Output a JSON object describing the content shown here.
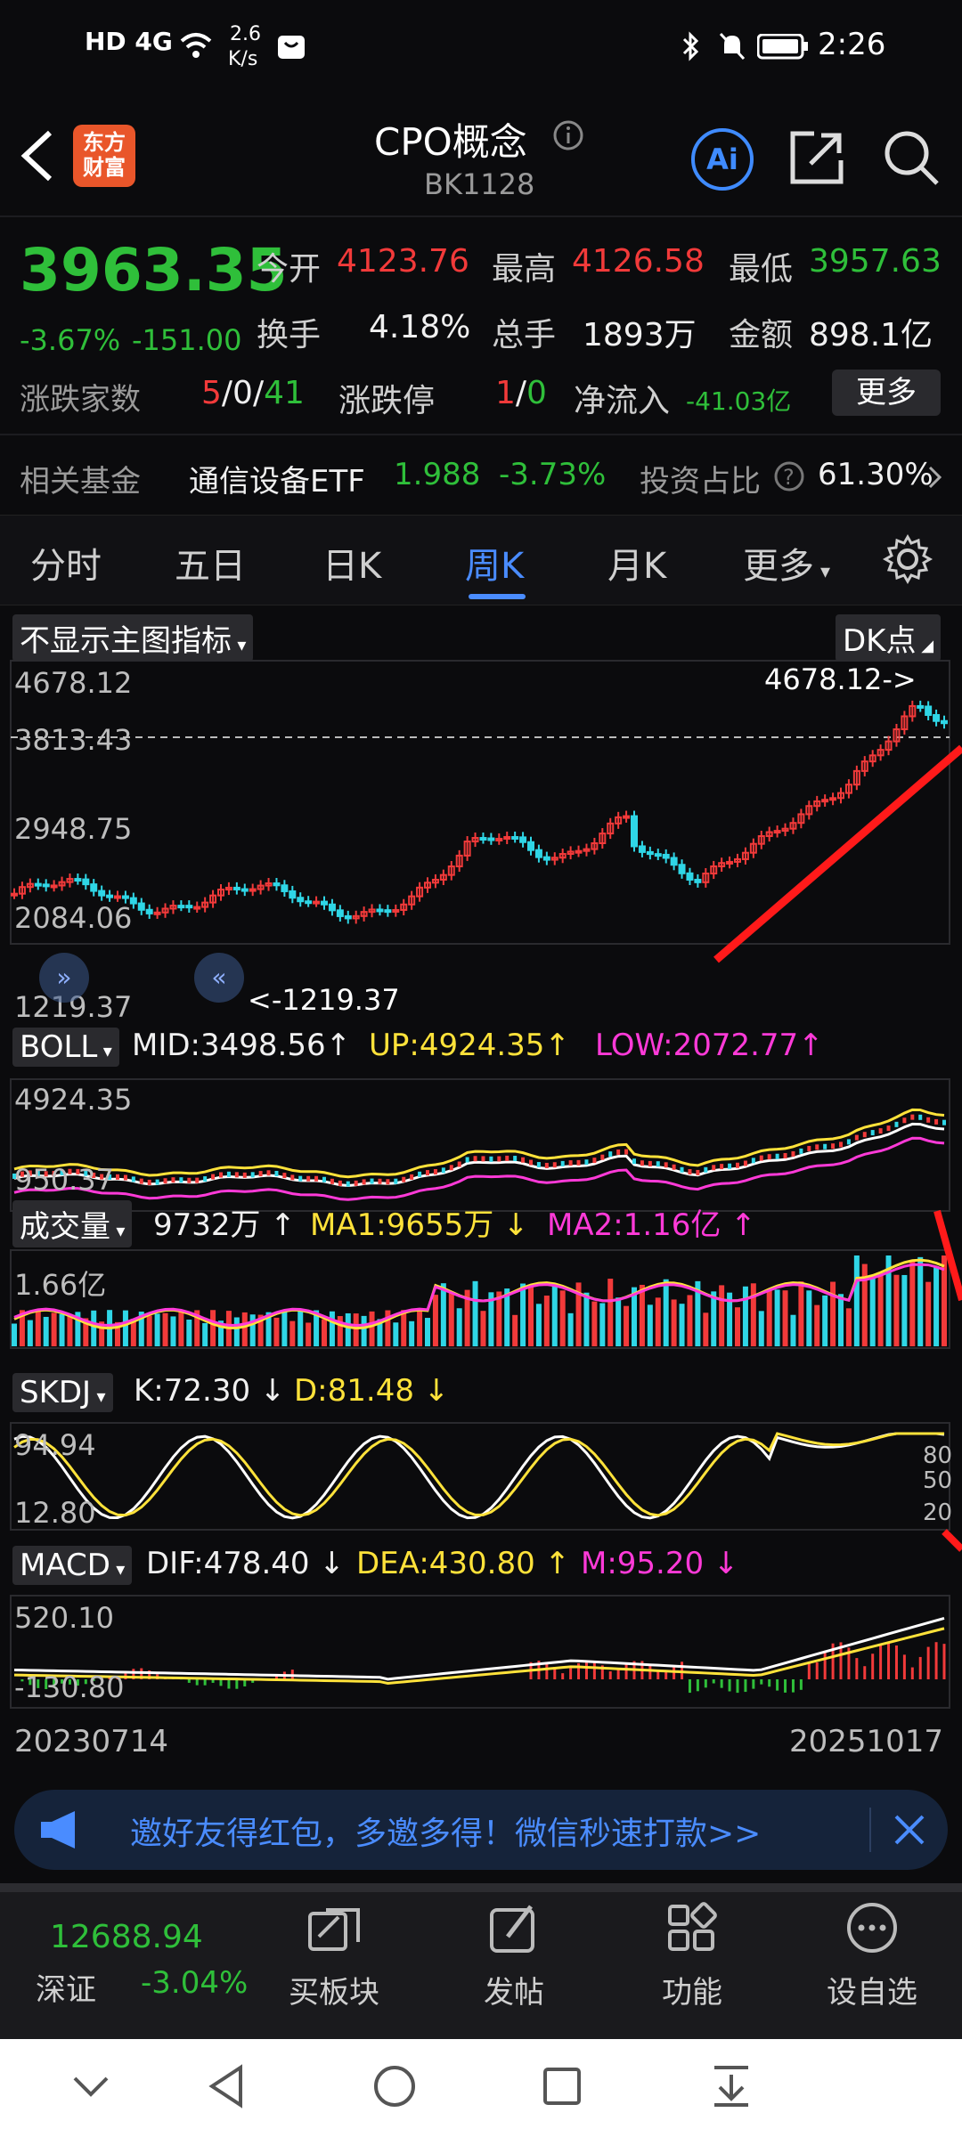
{
  "status_bar": {
    "left_icons": "HD 4G",
    "speed": "2.6",
    "speed_unit": "K/s",
    "time": "2:26"
  },
  "header": {
    "logo_line1": "东方",
    "logo_line2": "财富",
    "title": "CPO概念",
    "code": "BK1128",
    "ai_label": "Ai"
  },
  "quote": {
    "price": "3963.35",
    "change_pct": "-3.67%",
    "change_amt": "-151.00",
    "open_label": "今开",
    "open": "4123.76",
    "high_label": "最高",
    "high": "4126.58",
    "low_label": "最低",
    "low": "3957.63",
    "turnover_label": "换手",
    "turnover": "4.18%",
    "volume_label": "总手",
    "volume": "1893万",
    "amount_label": "金额",
    "amount": "898.1亿",
    "updown_label": "涨跌家数",
    "up": "5",
    "flat": "0",
    "down": "41",
    "limit_label": "涨跌停",
    "limit_up": "1",
    "limit_down": "0",
    "netflow_label": "净流入",
    "netflow": "-41.03亿",
    "more_button": "更多",
    "fund_label": "相关基金",
    "fund_name": "通信设备ETF",
    "fund_price": "1.988",
    "fund_change": "-3.73%",
    "ratio_label": "投资占比",
    "ratio": "61.30%"
  },
  "tabs": [
    "分时",
    "五日",
    "日K",
    "周K",
    "月K",
    "更多"
  ],
  "active_tab": "周K",
  "chart": {
    "main_indicator_button": "不显示主图指标",
    "dk_button": "DK点",
    "price_axis": [
      "4678.12",
      "3813.43",
      "2948.75",
      "2084.06",
      "1219.37"
    ],
    "high_marker": "4678.12->",
    "low_marker": "<-1219.37",
    "boll": {
      "label": "BOLL",
      "mid": "MID:3498.56",
      "up": "UP:4924.35",
      "low": "LOW:2072.77",
      "axis_top": "4924.35",
      "axis_bottom": "950.37"
    },
    "vol": {
      "label": "成交量",
      "value": "9732万",
      "ma1": "MA1:9655万",
      "ma2": "MA2:1.16亿",
      "axis_top": "1.66亿"
    },
    "skdj": {
      "label": "SKDJ",
      "k": "K:72.30",
      "d": "D:81.48",
      "axis_top": "94.94",
      "axis_bottom": "12.80",
      "right_top": "80",
      "right_mid": "50",
      "right_bottom": "20"
    },
    "macd": {
      "label": "MACD",
      "dif": "DIF:478.40",
      "dea": "DEA:430.80",
      "m": "M:95.20",
      "axis_top": "520.10",
      "axis_bottom": "-130.80"
    },
    "date_start": "20230714",
    "date_end": "20251017"
  },
  "banner": {
    "text": "邀好友得红包，多邀多得！微信秒速打款>>"
  },
  "bottom_bar": {
    "index_value": "12688.94",
    "index_name": "深证",
    "index_change": "-3.04%",
    "items": [
      "买板块",
      "发帖",
      "功能",
      "设自选"
    ]
  },
  "colors": {
    "up": "#f23a3a",
    "down": "#2fbf3a",
    "accent": "#4a8cff",
    "bg": "#0b0b0d"
  }
}
